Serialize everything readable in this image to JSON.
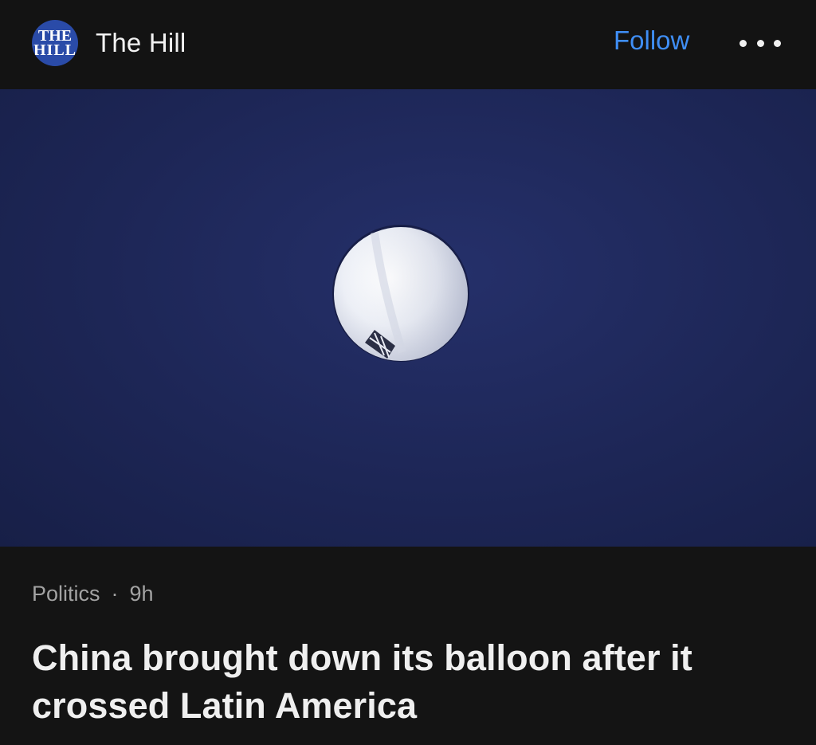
{
  "publisher": {
    "logo_line1": "THE",
    "logo_line2": "HILL",
    "name": "The Hill",
    "logo_color": "#2a4ba8"
  },
  "header": {
    "follow_label": "Follow",
    "more_icon": "more-horizontal-icon",
    "accent_color": "#3f8ef5"
  },
  "hero": {
    "image_subject": "balloon"
  },
  "article": {
    "category": "Politics",
    "separator": "·",
    "age": "9h",
    "headline": "China brought down its balloon after it crossed Latin America"
  }
}
